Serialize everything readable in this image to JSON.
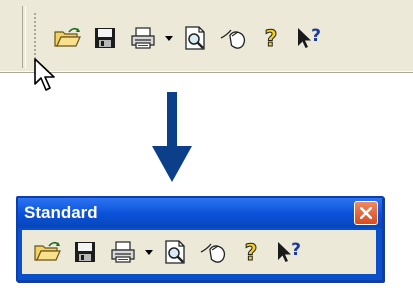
{
  "floating_toolbar": {
    "title": "Standard"
  },
  "toolbar": {
    "tools": [
      {
        "name": "open-folder-icon"
      },
      {
        "name": "save-disk-icon"
      },
      {
        "name": "print-icon"
      },
      {
        "name": "print-preview-icon"
      },
      {
        "name": "mouse-icon"
      },
      {
        "name": "help-icon"
      },
      {
        "name": "context-help-icon"
      }
    ]
  },
  "colors": {
    "toolbar_bg": "#ece9d8",
    "title_bar": "#0a50d8",
    "arrow": "#0b3f8a",
    "close_button": "#d84a22"
  }
}
